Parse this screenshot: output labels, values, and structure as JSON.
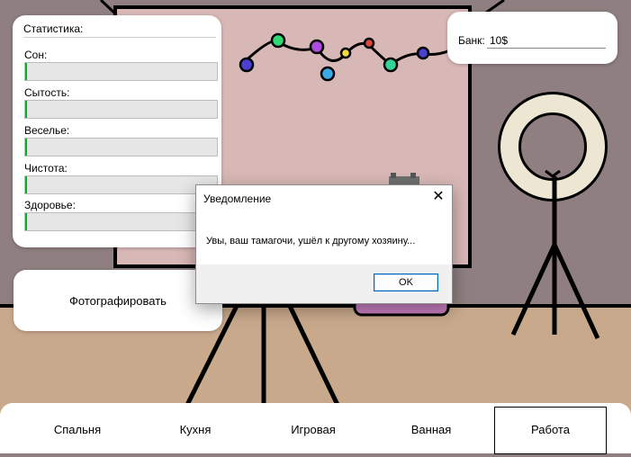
{
  "stats": {
    "title": "Статистика:",
    "items": [
      {
        "label": "Сон:",
        "level": 0.01
      },
      {
        "label": "Сытость:",
        "level": 0.01
      },
      {
        "label": "Веселье:",
        "level": 0.01
      },
      {
        "label": "Чистота:",
        "level": 0.01
      },
      {
        "label": "Здоровье:",
        "level": 0.01
      }
    ]
  },
  "bank": {
    "label": "Банк:",
    "value": "10$"
  },
  "photo_button": "Фотографировать",
  "nav": {
    "items": [
      "Спальня",
      "Кухня",
      "Игровая",
      "Ванная",
      "Работа"
    ],
    "active": "Работа"
  },
  "dialog": {
    "title": "Уведомление",
    "message": "Увы, ваш тамагочи, ушёл к другому хозяину...",
    "ok_label": "OK"
  },
  "colors": {
    "wall": "#8f7f80",
    "floor": "#c9a98c",
    "backdrop": "#d8b8b6",
    "progress_fill": "#06b025",
    "ring_light": "#ede6d3"
  }
}
